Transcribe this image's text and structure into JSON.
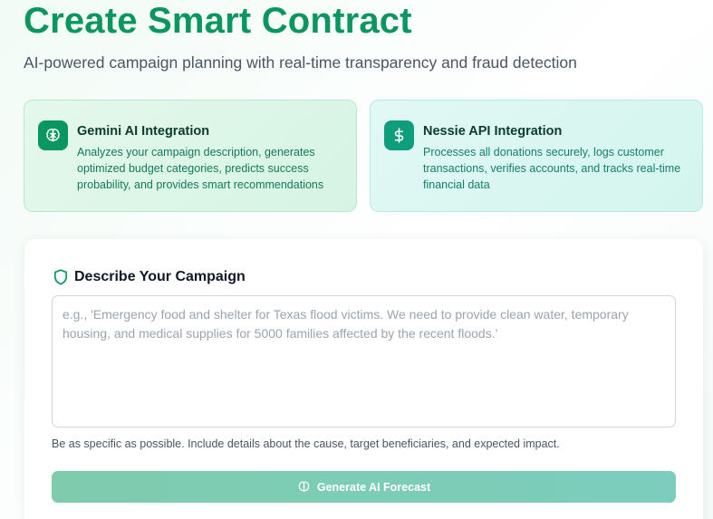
{
  "header": {
    "title": "Create Smart Contract",
    "subtitle": "AI-powered campaign planning with real-time transparency and fraud detection"
  },
  "integrations": [
    {
      "title": "Gemini AI Integration",
      "description": "Analyzes your campaign description, generates optimized budget categories, predicts success probability, and provides smart recommendations",
      "icon": "brain-icon",
      "icon_bg": "#0a9660"
    },
    {
      "title": "Nessie API Integration",
      "description": "Processes all donations securely, logs customer transactions, verifies accounts, and tracks real-time financial data",
      "icon": "dollar-icon",
      "icon_bg": "#0f9e7b"
    }
  ],
  "campaign": {
    "section_title": "Describe Your Campaign",
    "section_icon": "shield-icon",
    "input_value": "",
    "placeholder": "e.g., 'Emergency food and shelter for Texas flood victims. We need to provide clean water, temporary housing, and medical supplies for 5000 families affected by the recent floods.'",
    "helper_text": "Be as specific as possible. Include details about the cause, target beneficiaries, and expected impact.",
    "button_label": "Generate AI Forecast",
    "button_icon": "brain-icon",
    "button_disabled": true
  },
  "colors": {
    "brand": "#0a9660",
    "button_disabled": "#7ecbae"
  }
}
